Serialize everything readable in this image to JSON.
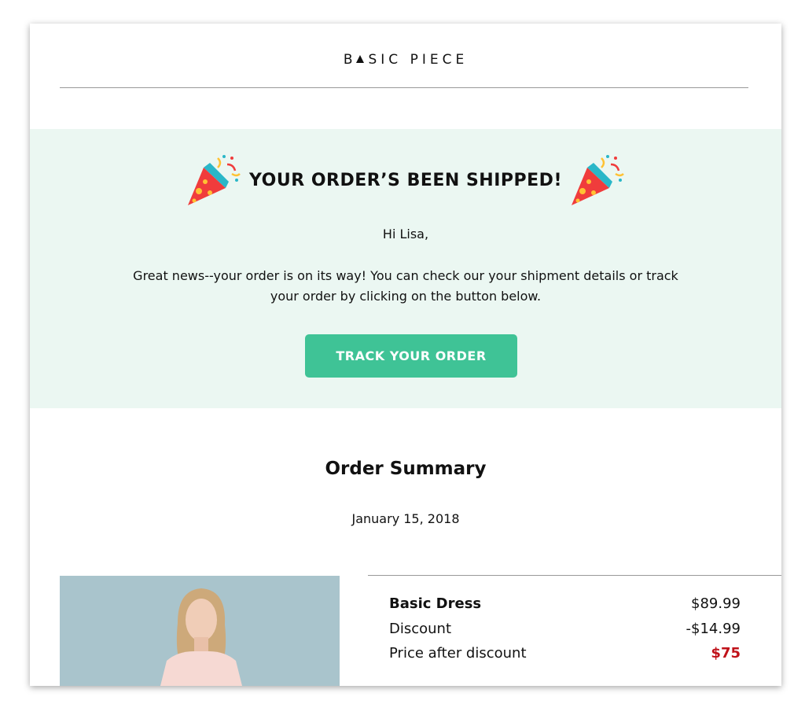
{
  "header": {
    "logo_part1": "B",
    "logo_part2": "SIC PIECE"
  },
  "hero": {
    "title": "YOUR ORDER’S BEEN SHIPPED!",
    "greeting": "Hi Lisa,",
    "message": "Great news--your order is on its way! You can check our your shipment details or track your order by clicking on the button below.",
    "button_label": "TRACK YOUR ORDER",
    "background_color": "#ebf7f2",
    "button_color": "#3fc396",
    "left_icon": "party-popper-icon",
    "right_icon": "party-popper-icon"
  },
  "summary": {
    "title": "Order Summary",
    "date": "January 15, 2018",
    "items": [
      {
        "label": "Basic Dress",
        "price": "$89.99"
      },
      {
        "label": "Discount",
        "price": "-$14.99"
      },
      {
        "label": "Price after discount",
        "price": "$75"
      }
    ],
    "highlight_color": "#c0121a"
  }
}
